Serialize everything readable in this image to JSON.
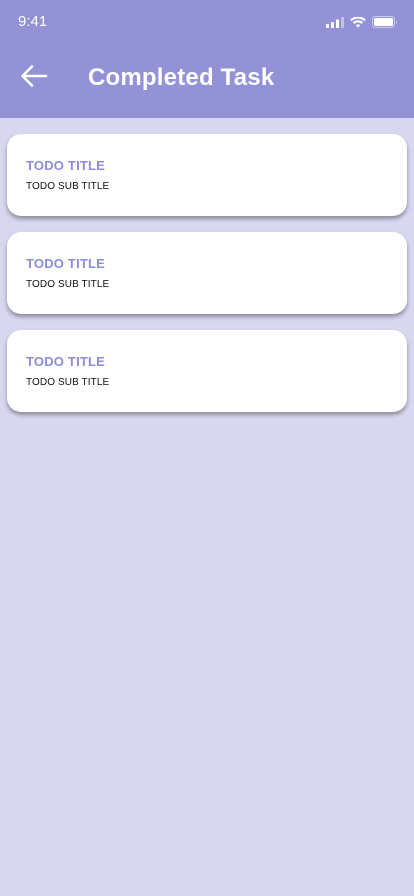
{
  "status_bar": {
    "time": "9:41",
    "icons": [
      "cellular-signal-icon",
      "wifi-icon",
      "battery-icon"
    ]
  },
  "header": {
    "back_icon": "arrow-left-icon",
    "title": "Completed Task"
  },
  "tasks": [
    {
      "title": "TODO TITLE",
      "subtitle": "TODO SUB TITLE"
    },
    {
      "title": "TODO TITLE",
      "subtitle": "TODO SUB TITLE"
    },
    {
      "title": "TODO TITLE",
      "subtitle": "TODO SUB TITLE"
    }
  ],
  "colors": {
    "header_bg": "#9392D6",
    "page_bg": "#D8D7F0",
    "card_bg": "#FFFFFF",
    "title_accent": "#8E8CD8"
  }
}
